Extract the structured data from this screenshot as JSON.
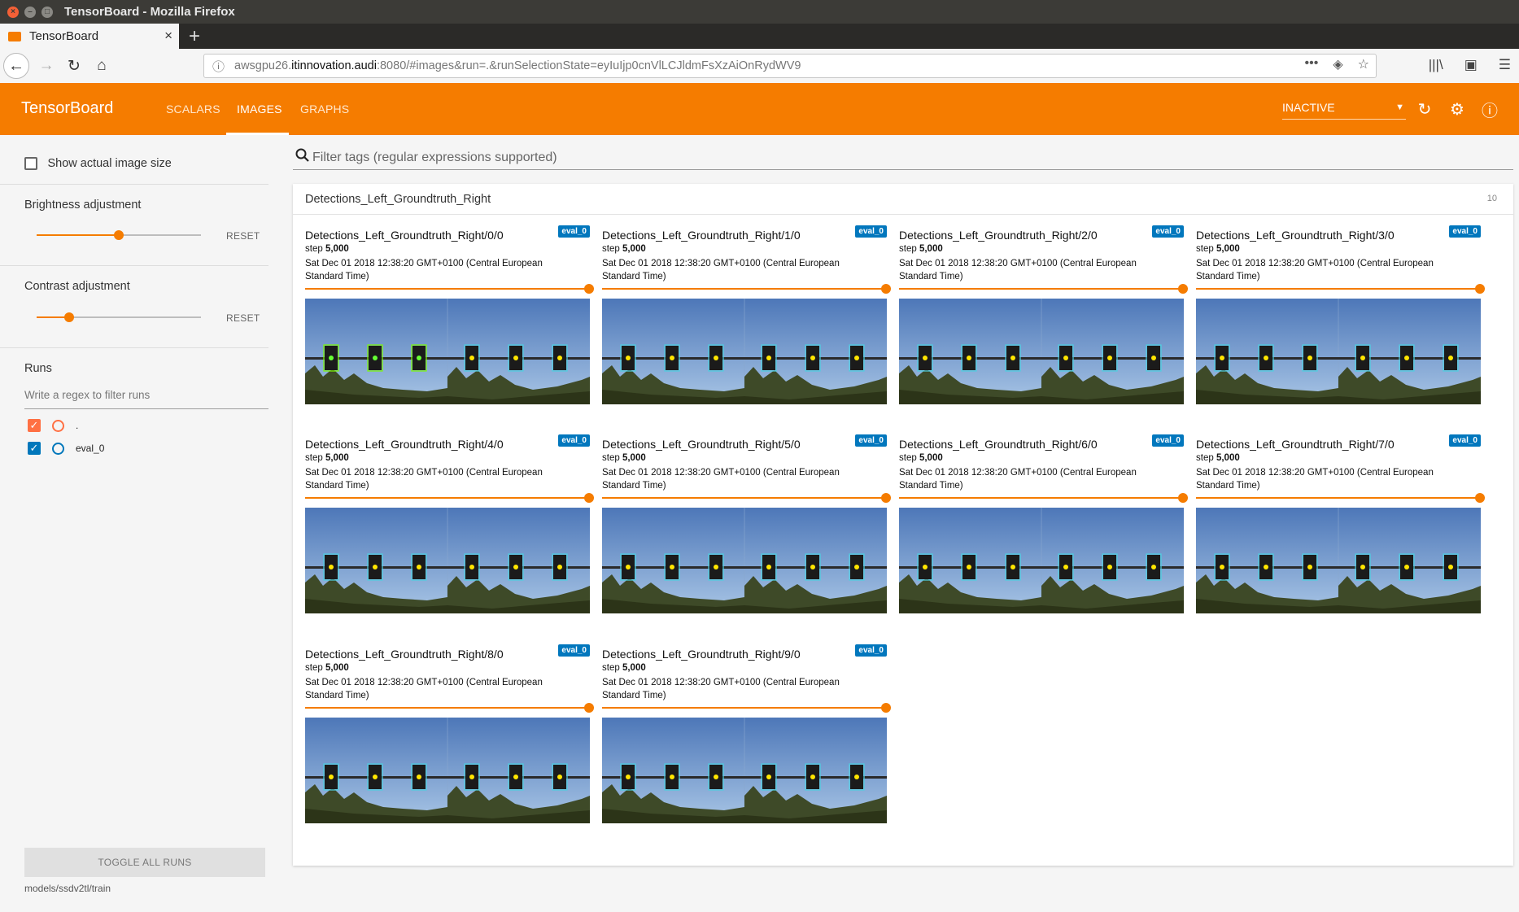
{
  "window": {
    "title": "TensorBoard - Mozilla Firefox"
  },
  "browser": {
    "tab_title": "TensorBoard",
    "url_host": "awsgpu26.itinnovation.audi",
    "url_prefix": "awsgpu26.",
    "url_host_bold": "itinnovation.audi",
    "url_rest": ":8080/#images&run=.&runSelectionState=eyIuIjp0cnVlLCJldmFsXzAiOnRydWV9"
  },
  "header": {
    "logo": "TensorBoard",
    "tabs": [
      {
        "label": "SCALARS",
        "active": false
      },
      {
        "label": "IMAGES",
        "active": true
      },
      {
        "label": "GRAPHS",
        "active": false
      }
    ],
    "selector_value": "INACTIVE"
  },
  "sidebar": {
    "show_actual_size_label": "Show actual image size",
    "brightness": {
      "label": "Brightness adjustment",
      "value": 0.5,
      "reset": "RESET"
    },
    "contrast": {
      "label": "Contrast adjustment",
      "value": 0.2,
      "reset": "RESET"
    },
    "runs_title": "Runs",
    "runs_filter_placeholder": "Write a regex to filter runs",
    "runs": [
      {
        "name": ".",
        "checked": true,
        "color": "#ff7043"
      },
      {
        "name": "eval_0",
        "checked": true,
        "color": "#0077bb"
      }
    ],
    "toggle_all": "TOGGLE ALL RUNS",
    "logdir": "models/ssdv2tl/train"
  },
  "main": {
    "filter_placeholder": "Filter tags (regular expressions supported)",
    "group": {
      "title": "Detections_Left_Groundtruth_Right",
      "count": "10"
    },
    "cards": [
      {
        "title": "Detections_Left_Groundtruth_Right/0/0",
        "badge": "eval_0",
        "step_label": "step",
        "step": "5,000",
        "time": "Sat Dec 01 2018 12:38:20 GMT+0100 (Central European Standard Time)"
      },
      {
        "title": "Detections_Left_Groundtruth_Right/1/0",
        "badge": "eval_0",
        "step_label": "step",
        "step": "5,000",
        "time": "Sat Dec 01 2018 12:38:20 GMT+0100 (Central European Standard Time)"
      },
      {
        "title": "Detections_Left_Groundtruth_Right/2/0",
        "badge": "eval_0",
        "step_label": "step",
        "step": "5,000",
        "time": "Sat Dec 01 2018 12:38:20 GMT+0100 (Central European Standard Time)"
      },
      {
        "title": "Detections_Left_Groundtruth_Right/3/0",
        "badge": "eval_0",
        "step_label": "step",
        "step": "5,000",
        "time": "Sat Dec 01 2018 12:38:20 GMT+0100 (Central European Standard Time)"
      },
      {
        "title": "Detections_Left_Groundtruth_Right/4/0",
        "badge": "eval_0",
        "step_label": "step",
        "step": "5,000",
        "time": "Sat Dec 01 2018 12:38:20 GMT+0100 (Central European Standard Time)"
      },
      {
        "title": "Detections_Left_Groundtruth_Right/5/0",
        "badge": "eval_0",
        "step_label": "step",
        "step": "5,000",
        "time": "Sat Dec 01 2018 12:38:20 GMT+0100 (Central European Standard Time)"
      },
      {
        "title": "Detections_Left_Groundtruth_Right/6/0",
        "badge": "eval_0",
        "step_label": "step",
        "step": "5,000",
        "time": "Sat Dec 01 2018 12:38:20 GMT+0100 (Central European Standard Time)"
      },
      {
        "title": "Detections_Left_Groundtruth_Right/7/0",
        "badge": "eval_0",
        "step_label": "step",
        "step": "5,000",
        "time": "Sat Dec 01 2018 12:38:20 GMT+0100 (Central European Standard Time)"
      },
      {
        "title": "Detections_Left_Groundtruth_Right/8/0",
        "badge": "eval_0",
        "step_label": "step",
        "step": "5,000",
        "time": "Sat Dec 01 2018 12:38:20 GMT+0100 (Central European Standard Time)"
      },
      {
        "title": "Detections_Left_Groundtruth_Right/9/0",
        "badge": "eval_0",
        "step_label": "step",
        "step": "5,000",
        "time": "Sat Dec 01 2018 12:38:20 GMT+0100 (Central European Standard Time)"
      }
    ]
  },
  "colors": {
    "accent": "#f57c00",
    "badge": "#0277bd"
  }
}
